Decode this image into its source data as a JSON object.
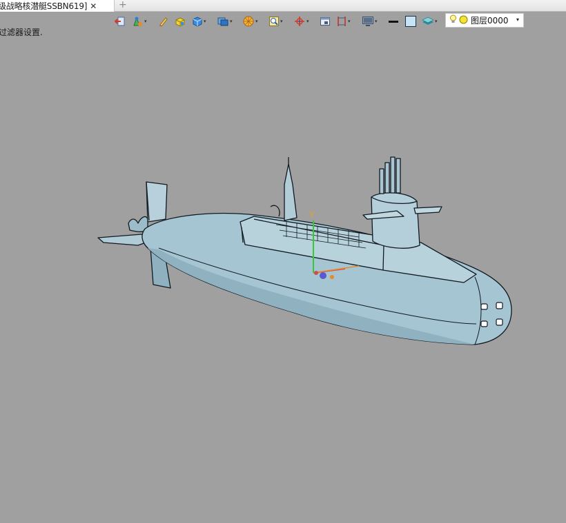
{
  "tab": {
    "title": "级战略核潜艇SSBN619]",
    "close_glyph": "✕",
    "new_tab_glyph": "+"
  },
  "status": {
    "filter_text": "过滤器设置."
  },
  "toolbar": {
    "layer": {
      "value": "图层0000",
      "caret": "▾"
    },
    "dropdown_caret": "▾",
    "icons": [
      "exit-icon",
      "part-color-icon",
      "pencil-icon",
      "box-solid-icon",
      "cube-icon",
      "view-orientation-icon",
      "render-sphere-icon",
      "zoom-frame-icon",
      "axis-triad-icon",
      "window-icon",
      "dimension-icon",
      "monitor-icon",
      "line-weight-icon",
      "fill-color-icon",
      "layer-stack-icon"
    ]
  },
  "viewport": {
    "model": "submarine-3d-model",
    "background": "#a0a0a0",
    "hull_color": "#a4c4d1"
  }
}
